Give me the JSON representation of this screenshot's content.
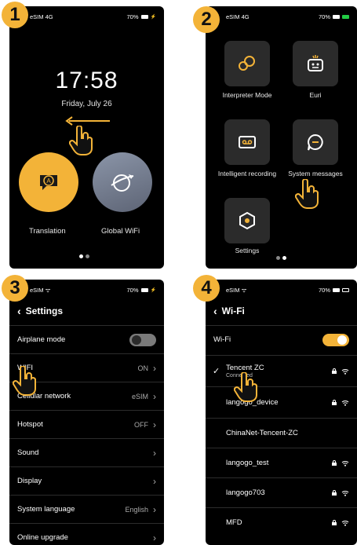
{
  "steps": [
    "1",
    "2",
    "3",
    "4"
  ],
  "panel1": {
    "status_left": "eSIM 4G",
    "status_right": "70%",
    "time": "17:58",
    "date": "Friday, July 26",
    "apps": [
      {
        "label": "Translation",
        "icon": "translation-bubble-icon"
      },
      {
        "label": "Global WiFi",
        "icon": "globe-plane-icon"
      }
    ]
  },
  "panel2": {
    "status_left": "eSIM 4G",
    "status_right": "70%",
    "apps": [
      {
        "label": "Interpreter Mode",
        "icon": "interpreter-icon"
      },
      {
        "label": "Euri",
        "icon": "robot-icon"
      },
      {
        "label": "Intelligent recording",
        "icon": "cassette-icon"
      },
      {
        "label": "System messages",
        "icon": "message-icon"
      },
      {
        "label": "Settings",
        "icon": "hexagon-settings-icon"
      }
    ]
  },
  "panel3": {
    "status_left": "eSIM",
    "status_right": "70%",
    "title": "Settings",
    "rows": [
      {
        "label": "Airplane mode",
        "value": "",
        "control": "toggle-off"
      },
      {
        "label": "WIFI",
        "value": "ON",
        "control": "chevron"
      },
      {
        "label": "Cellular network",
        "value": "eSIM",
        "control": "chevron"
      },
      {
        "label": "Hotspot",
        "value": "OFF",
        "control": "chevron"
      },
      {
        "label": "Sound",
        "value": "",
        "control": "chevron"
      },
      {
        "label": "Display",
        "value": "",
        "control": "chevron"
      },
      {
        "label": "System language",
        "value": "English",
        "control": "chevron"
      },
      {
        "label": "Online upgrade",
        "value": "",
        "control": "chevron"
      }
    ]
  },
  "panel4": {
    "status_left": "eSIM",
    "status_right": "70%",
    "title": "Wi-Fi",
    "wifi_label": "Wi-Fi",
    "networks": [
      {
        "name": "Tencent ZC",
        "status": "Connected"
      },
      {
        "name": "langogo_device",
        "status": ""
      },
      {
        "name": "ChinaNet-Tencent-ZC",
        "status": ""
      },
      {
        "name": "langogo_test",
        "status": ""
      },
      {
        "name": "langogo703",
        "status": ""
      },
      {
        "name": "MFD",
        "status": ""
      }
    ]
  },
  "colors": {
    "accent": "#f3b338",
    "background": "#000000",
    "tile": "#2b2b2b"
  }
}
